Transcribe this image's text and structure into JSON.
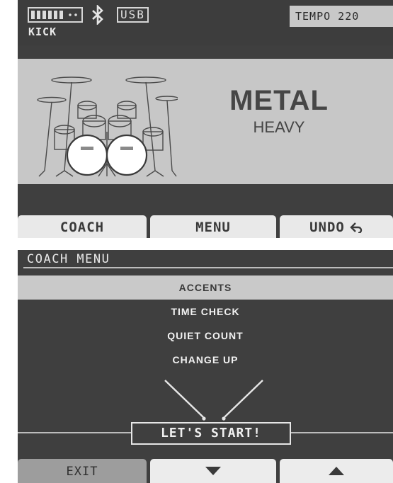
{
  "screen1": {
    "status": {
      "usb_label": "USB",
      "kick_label": "KICK",
      "tempo_label": "TEMPO 220",
      "icons": [
        "battery-icon",
        "bluetooth-icon"
      ]
    },
    "kit": {
      "style": "METAL",
      "variation": "HEAVY",
      "icons": [
        "drum-kit-icon"
      ]
    },
    "softkeys": {
      "coach": "COACH",
      "menu": "MENU",
      "undo": "UNDO",
      "icons": [
        "undo-arrow-icon"
      ]
    }
  },
  "screen2": {
    "title": "COACH MENU",
    "items": [
      {
        "label": "ACCENTS",
        "selected": true
      },
      {
        "label": "TIME CHECK",
        "selected": false
      },
      {
        "label": "QUIET COUNT",
        "selected": false
      },
      {
        "label": "CHANGE UP",
        "selected": false
      }
    ],
    "start_label": "LET'S START!",
    "softkeys": {
      "exit": "EXIT",
      "icons": [
        "down-arrow-icon",
        "up-arrow-icon",
        "drumsticks-icon"
      ]
    }
  },
  "colors": {
    "screen_bg": "#3f3f3f",
    "panel_bg": "#c7c7c7",
    "softkey_bg": "#e9e9e9",
    "text_dark": "#3a3a3a",
    "text_light": "#f2f2f2"
  }
}
